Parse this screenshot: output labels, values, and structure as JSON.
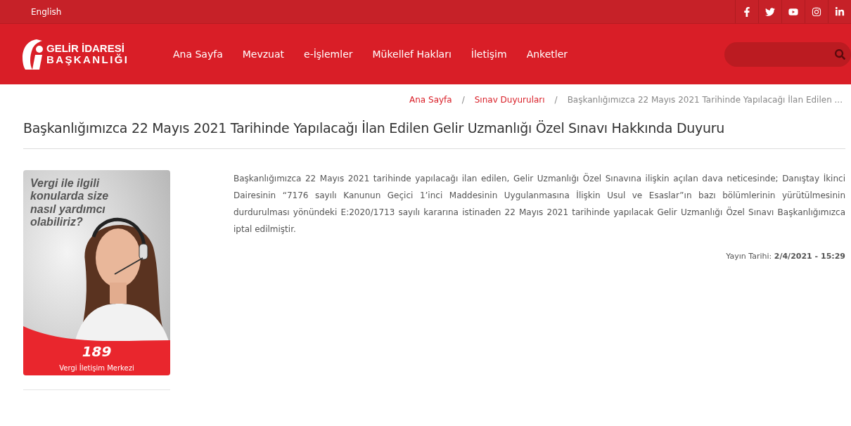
{
  "top_bar": {
    "language_link": "English",
    "social": [
      {
        "kind": "facebook"
      },
      {
        "kind": "twitter"
      },
      {
        "kind": "youtube"
      },
      {
        "kind": "instagram"
      },
      {
        "kind": "linkedin"
      }
    ]
  },
  "header": {
    "logo": {
      "line1": "GELİR İDARESİ",
      "line2": "BAŞKANLIĞI"
    },
    "nav": [
      "Ana Sayfa",
      "Mevzuat",
      "e-İşlemler",
      "Mükellef Hakları",
      "İletişim",
      "Anketler"
    ]
  },
  "breadcrumb": [
    {
      "label": "Ana Sayfa",
      "kind": "link"
    },
    {
      "separator": "/",
      "label": "Sınav Duyuruları",
      "kind": "link"
    },
    {
      "separator": "/",
      "label": "Başkanlığımızca 22 Mayıs 2021 Tarihinde Yapılacağı İlan Edilen ...",
      "kind": "current"
    }
  ],
  "title": "Başkanlığımızca 22 Mayıs 2021 Tarihinde Yapılacağı İlan Edilen Gelir Uzmanlığı Özel Sınavı Hakkında Duyuru",
  "banner": {
    "headline": "Vergi ile ilgili konularda size nasıl yardımcı olabiliriz?",
    "number": "189",
    "caption": "Vergi İletişim Merkezi"
  },
  "body": "Başkanlığımızca 22 Mayıs 2021 tarihinde yapılacağı ilan edilen, Gelir Uzmanlığı Özel Sınavına ilişkin açılan dava neticesinde; Danıştay İkinci Dairesinin “7176 sayılı Kanunun Geçici 1’inci Maddesinin Uygulanmasına İlişkin Usul ve Esaslar”ın bazı bölümlerinin yürütülmesinin durdurulması yönündeki E:2020/1713 sayılı kararına istinaden 22 Mayıs 2021 tarihinde yapılacak Gelir Uzmanlığı Özel Sınavı Başkanlığımızca iptal edilmiştir.",
  "publish_date": "Yayın Tarihi: **2/4/2021 - 15:29**"
}
